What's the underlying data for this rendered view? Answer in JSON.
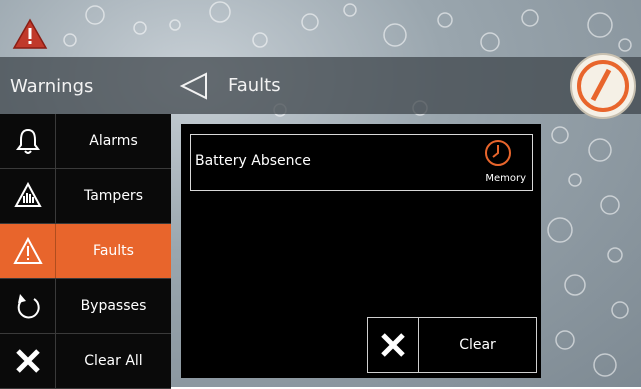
{
  "header": {
    "title": "Warnings",
    "subtitle": "Faults"
  },
  "sidebar": {
    "items": [
      {
        "label": "Alarms",
        "icon": "bell-icon",
        "active": false
      },
      {
        "label": "Tampers",
        "icon": "hand-icon",
        "active": false
      },
      {
        "label": "Faults",
        "icon": "warning-icon",
        "active": true
      },
      {
        "label": "Bypasses",
        "icon": "rotate-arrow-icon",
        "active": false
      },
      {
        "label": "Clear All",
        "icon": "x-icon",
        "active": false
      }
    ]
  },
  "panel": {
    "faults": [
      {
        "name": "Battery Absence",
        "status_label": "Memory",
        "status_icon": "clock-icon"
      }
    ],
    "clear_label": "Clear"
  },
  "colors": {
    "accent": "#e8652c",
    "warning_red": "#c0392b"
  }
}
